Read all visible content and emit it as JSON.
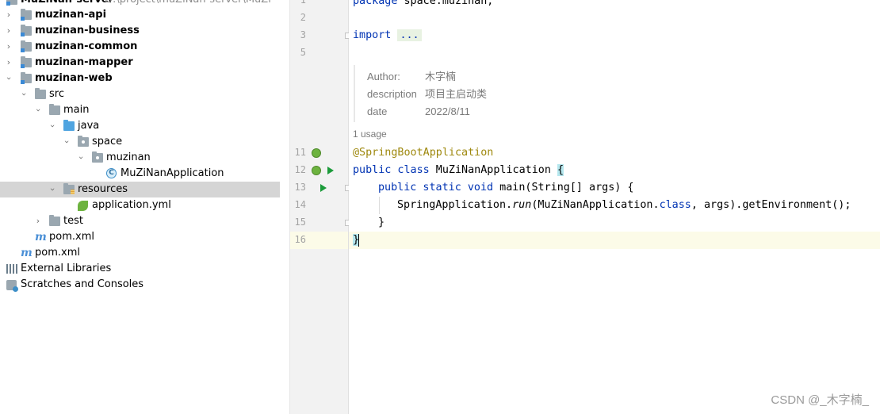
{
  "project_tree": {
    "root": {
      "label": "MuZiNan-server",
      "path": "D:\\project\\muZiNan-server\\MuZi"
    },
    "items": [
      {
        "label": "muzinan-api"
      },
      {
        "label": "muzinan-business"
      },
      {
        "label": "muzinan-common"
      },
      {
        "label": "muzinan-mapper"
      },
      {
        "label": "muzinan-web"
      },
      {
        "label": "src"
      },
      {
        "label": "main"
      },
      {
        "label": "java"
      },
      {
        "label": "space"
      },
      {
        "label": "muzinan"
      },
      {
        "label": "MuZiNanApplication"
      },
      {
        "label": "resources"
      },
      {
        "label": "application.yml"
      },
      {
        "label": "test"
      },
      {
        "label": "pom.xml"
      },
      {
        "label": "pom.xml"
      },
      {
        "label": "External Libraries"
      },
      {
        "label": "Scratches and Consoles"
      }
    ]
  },
  "gutter": {
    "line_numbers": [
      "1",
      "2",
      "3",
      "5",
      "11",
      "12",
      "13",
      "14",
      "15",
      "16"
    ]
  },
  "editor": {
    "line1": {
      "kw": "package",
      "rest": " space.muzinan;"
    },
    "line3": {
      "kw": "import",
      "folded": "..."
    },
    "doc": {
      "author_key": "Author:",
      "author_val": "木字楠",
      "desc_key": "description",
      "desc_val": "项目主启动类",
      "date_key": "date",
      "date_val": "2022/8/11"
    },
    "usage": "1 usage",
    "annotation": "@SpringBootApplication",
    "class_decl": {
      "kw": "public class",
      "name": " MuZiNanApplication ",
      "brace": "{"
    },
    "main_decl": {
      "kw": "public static void",
      "rest": " main(String[] args) {"
    },
    "body": {
      "a": "SpringApplication.",
      "run": "run",
      "b": "(MuZiNanApplication.",
      "cls": "class",
      "c": ", args).getEnvironment();"
    },
    "close_inner": "}",
    "close_outer": "}"
  },
  "watermark": "CSDN @_木字楠_"
}
